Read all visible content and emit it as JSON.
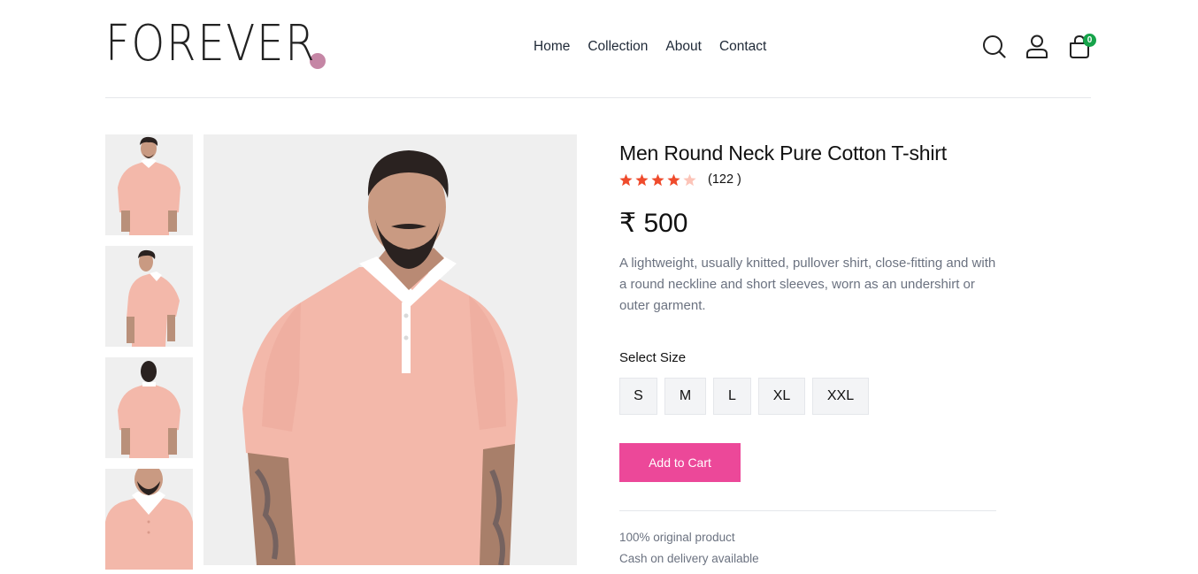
{
  "brand": {
    "logo_text": "FOREVER",
    "dot_color": "#c586a5"
  },
  "nav": {
    "items": [
      "Home",
      "Collection",
      "About",
      "Contact"
    ]
  },
  "header_icons": {
    "search": "search-icon",
    "profile": "user-icon",
    "cart": "shopping-bag-icon",
    "cart_count": "0"
  },
  "gallery": {
    "thumbnails": [
      "front-view",
      "side-view",
      "back-view",
      "collar-detail"
    ],
    "main_image": "front-view"
  },
  "product": {
    "title": "Men Round Neck Pure Cotton T-shirt",
    "rating": 4,
    "rating_max": 5,
    "reviews": "(122 )",
    "currency": "₹",
    "price": "500",
    "description": "A lightweight, usually knitted, pullover shirt, close-fitting and with a round neckline and short sleeves, worn as an undershirt or outer garment.",
    "size_label": "Select Size",
    "sizes": [
      "S",
      "M",
      "L",
      "XL",
      "XXL"
    ],
    "add_to_cart": "Add to Cart",
    "policies": [
      "100% original product",
      "Cash on delivery available"
    ]
  },
  "colors": {
    "accent": "#ec4899",
    "star": "#ef4b2c",
    "star_empty": "#fcc4b8",
    "badge": "#16a34a",
    "shirt": "#f3b8aa"
  }
}
